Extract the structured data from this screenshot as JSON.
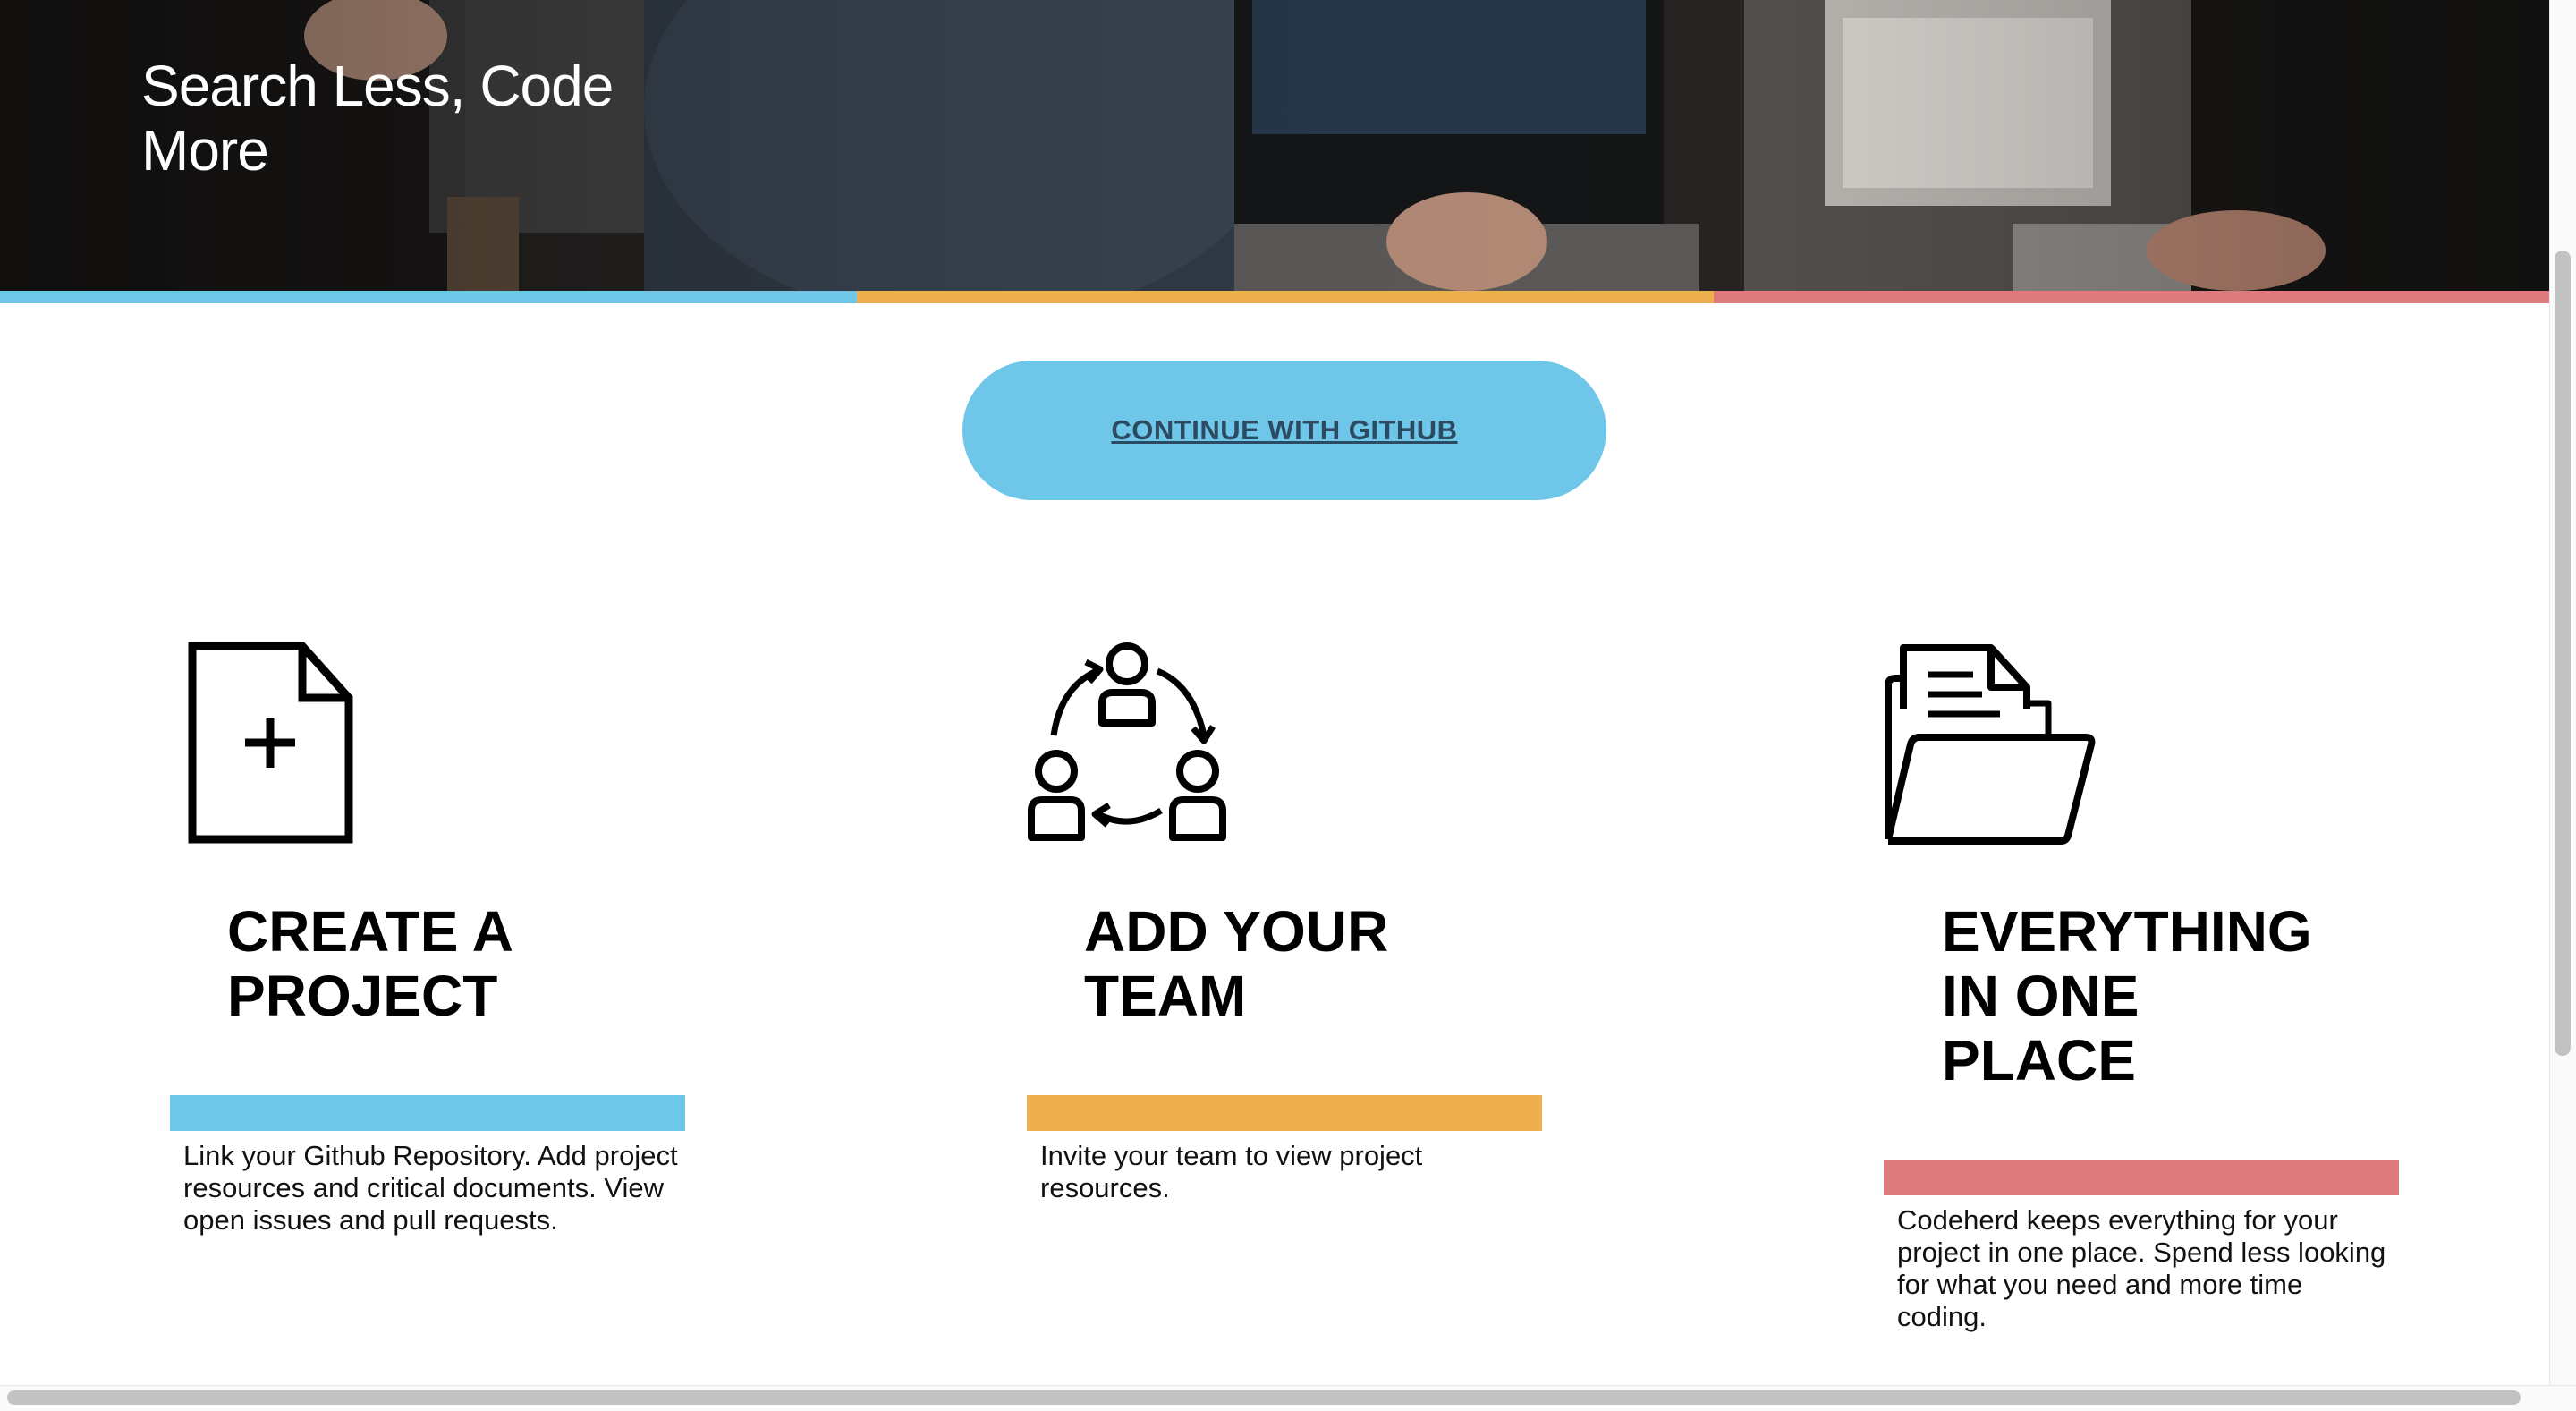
{
  "hero": {
    "title": "Search Less, Code More",
    "image_description_icon": "team-coding-photo"
  },
  "colors": {
    "blue": "#6ec6e8",
    "orange": "#eeb04e",
    "red": "#de7b7d",
    "cta_text": "#2d4a63"
  },
  "cta": {
    "label": "CONTINUE WITH GITHUB"
  },
  "features": [
    {
      "icon": "new-document-icon",
      "title_line1": "CREATE A",
      "title_line2": "PROJECT",
      "title_line3": "",
      "description": "Link your Github Repository. Add project resources and critical documents. View open issues and pull requests."
    },
    {
      "icon": "team-cycle-icon",
      "title_line1": "ADD YOUR",
      "title_line2": "TEAM",
      "title_line3": "",
      "description": "Invite your team to view project resources."
    },
    {
      "icon": "folder-documents-icon",
      "title_line1": "EVERYTHING",
      "title_line2": "IN ONE",
      "title_line3": "PLACE",
      "description": "Codeherd keeps everything for your project in one place. Spend less looking for what you need and more time coding."
    }
  ]
}
